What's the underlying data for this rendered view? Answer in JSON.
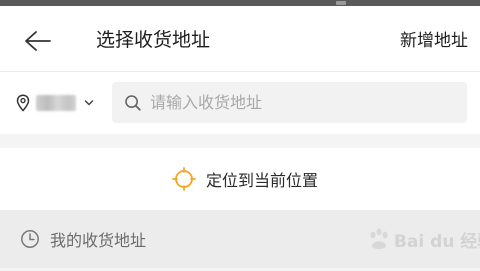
{
  "header": {
    "back_icon": "arrow-left-icon",
    "title": "选择收货地址",
    "add_address_label": "新增地址"
  },
  "search_bar": {
    "location_icon": "location-pin-icon",
    "city": "",
    "dropdown_icon": "chevron-down-icon",
    "search_icon": "search-icon",
    "placeholder": "请输入收货地址"
  },
  "locate": {
    "icon": "locate-target-icon",
    "label": "定位到当前位置",
    "accent_color": "#f5a623"
  },
  "my_addresses": {
    "icon": "clock-icon",
    "title": "我的收货地址"
  },
  "watermark": {
    "logo": "baidu-paw-logo",
    "text": "Bai du 经验"
  }
}
